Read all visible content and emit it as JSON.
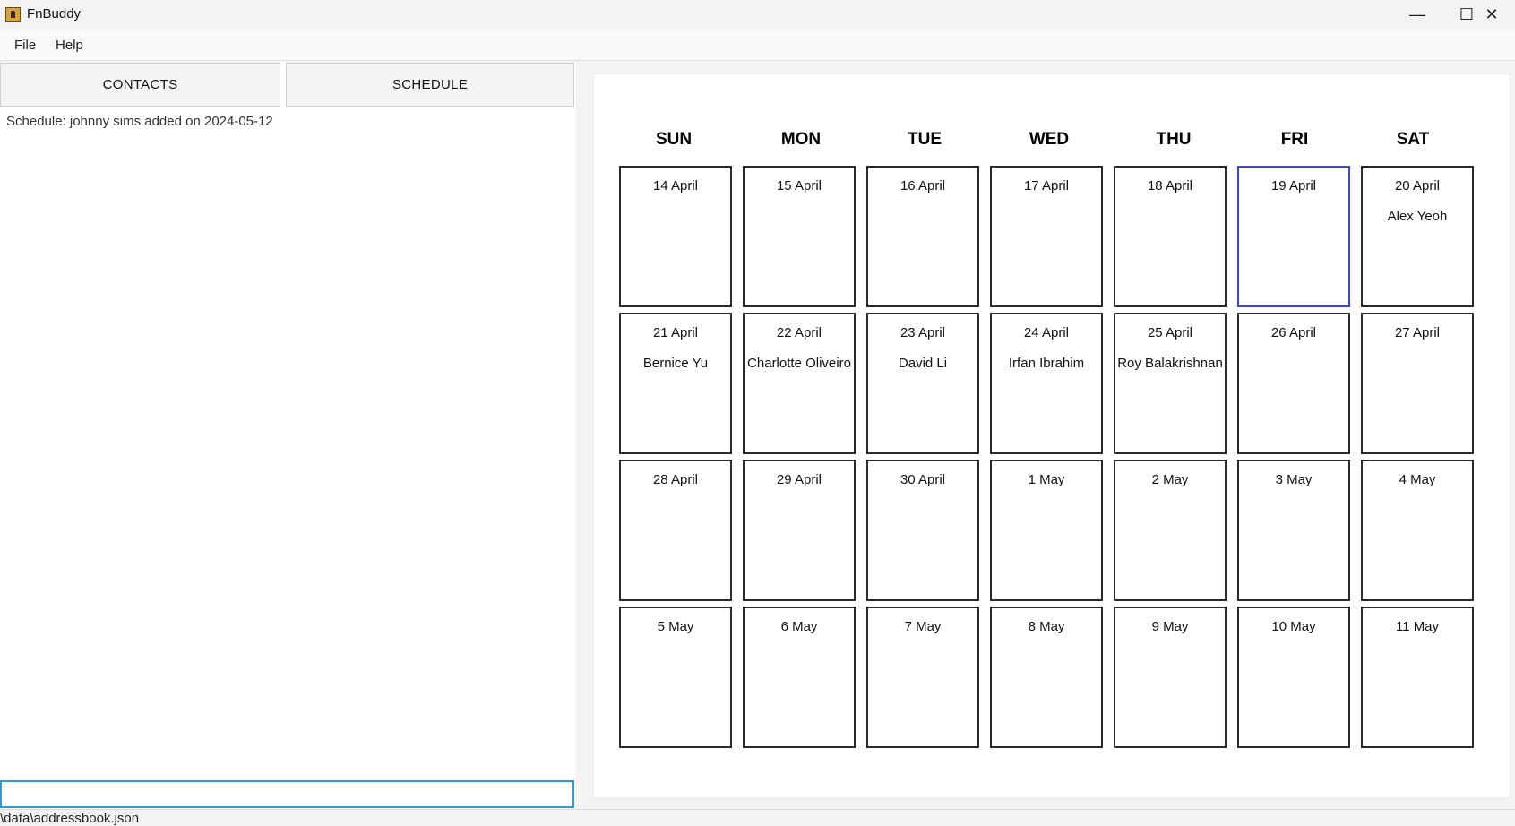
{
  "window": {
    "title": "FnBuddy",
    "minimize_glyph": "—",
    "maximize_glyph": "☐",
    "close_glyph": "✕"
  },
  "menu": [
    "File",
    "Help"
  ],
  "tabs": {
    "contacts": "CONTACTS",
    "schedule": "SCHEDULE"
  },
  "result_display": "Schedule: johnny sims added on 2024-05-12",
  "command_box": {
    "value": ""
  },
  "calendar": {
    "weekdays": [
      "SUN",
      "MON",
      "TUE",
      "WED",
      "THU",
      "FRI",
      "SAT"
    ],
    "today_index": 5,
    "highlight_color": "#3a47d5",
    "weeks": [
      [
        {
          "date": "14 April",
          "event": ""
        },
        {
          "date": "15 April",
          "event": ""
        },
        {
          "date": "16 April",
          "event": ""
        },
        {
          "date": "17 April",
          "event": ""
        },
        {
          "date": "18 April",
          "event": ""
        },
        {
          "date": "19 April",
          "event": ""
        },
        {
          "date": "20 April",
          "event": "Alex Yeoh"
        }
      ],
      [
        {
          "date": "21 April",
          "event": "Bernice Yu"
        },
        {
          "date": "22 April",
          "event": "Charlotte Oliveiro"
        },
        {
          "date": "23 April",
          "event": "David Li"
        },
        {
          "date": "24 April",
          "event": "Irfan Ibrahim"
        },
        {
          "date": "25 April",
          "event": "Roy Balakrishnan"
        },
        {
          "date": "26 April",
          "event": ""
        },
        {
          "date": "27 April",
          "event": ""
        }
      ],
      [
        {
          "date": "28 April",
          "event": ""
        },
        {
          "date": "29 April",
          "event": ""
        },
        {
          "date": "30 April",
          "event": ""
        },
        {
          "date": "1 May",
          "event": ""
        },
        {
          "date": "2 May",
          "event": ""
        },
        {
          "date": "3 May",
          "event": ""
        },
        {
          "date": "4 May",
          "event": ""
        }
      ],
      [
        {
          "date": "5 May",
          "event": ""
        },
        {
          "date": "6 May",
          "event": ""
        },
        {
          "date": "7 May",
          "event": ""
        },
        {
          "date": "8 May",
          "event": ""
        },
        {
          "date": "9 May",
          "event": ""
        },
        {
          "date": "10 May",
          "event": ""
        },
        {
          "date": "11 May",
          "event": ""
        }
      ]
    ]
  },
  "status_bar": "\\data\\addressbook.json"
}
